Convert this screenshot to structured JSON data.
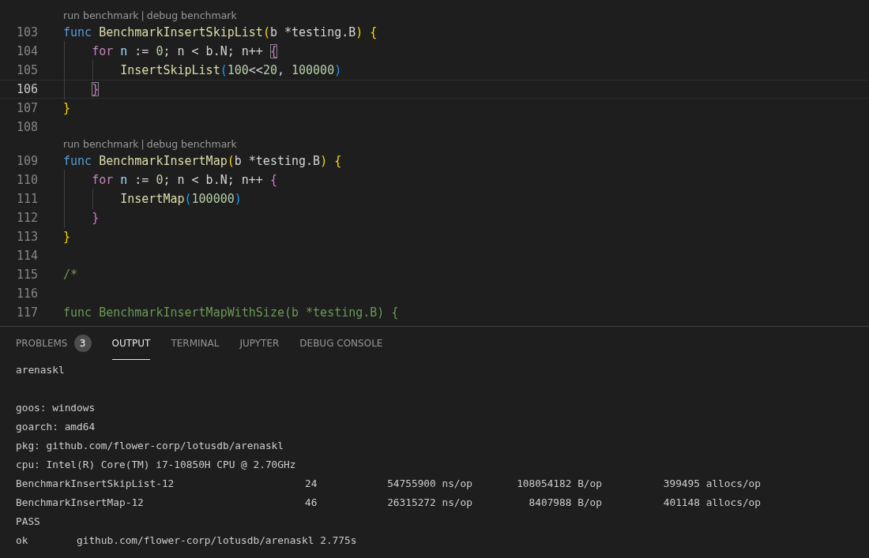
{
  "editor": {
    "lines": [
      {
        "kind": "lens",
        "run": "run benchmark",
        "sep": "|",
        "debug": "debug benchmark"
      },
      {
        "kind": "code",
        "number": "103",
        "current": false,
        "tokens": [
          {
            "kind": "kw",
            "t": "func"
          },
          {
            "kind": "fn",
            "t": " BenchmarkInsertSkipList"
          },
          {
            "kind": "brace1",
            "t": "("
          },
          {
            "kind": "plain",
            "t": "b *testing.B"
          },
          {
            "kind": "brace1",
            "t": ")"
          },
          {
            "kind": "brace1",
            "t": " {"
          }
        ]
      },
      {
        "kind": "code",
        "number": "104",
        "current": false,
        "tokens": [
          {
            "kind": "ctrl",
            "t": "    for"
          },
          {
            "kind": "var",
            "t": " n"
          },
          {
            "kind": "plain",
            "t": " := "
          },
          {
            "kind": "num",
            "t": "0"
          },
          {
            "kind": "plain",
            "t": "; n < b.N; n++ "
          },
          {
            "kind": "brace2",
            "t": "{",
            "matched": true
          }
        ]
      },
      {
        "kind": "code",
        "number": "105",
        "current": false,
        "tokens": [
          {
            "kind": "fn",
            "t": "        InsertSkipList"
          },
          {
            "kind": "brace3",
            "t": "("
          },
          {
            "kind": "num",
            "t": "100"
          },
          {
            "kind": "plain",
            "t": "<<"
          },
          {
            "kind": "num",
            "t": "20"
          },
          {
            "kind": "plain",
            "t": ", "
          },
          {
            "kind": "num",
            "t": "100000"
          },
          {
            "kind": "brace3",
            "t": ")"
          }
        ]
      },
      {
        "kind": "code",
        "number": "106",
        "current": true,
        "tokens": [
          {
            "kind": "brace2",
            "t": "    }",
            "matched": true
          }
        ]
      },
      {
        "kind": "code",
        "number": "107",
        "current": false,
        "tokens": [
          {
            "kind": "brace1",
            "t": "}"
          }
        ]
      },
      {
        "kind": "code",
        "number": "108",
        "current": false
      },
      {
        "kind": "lens",
        "run": "run benchmark",
        "sep": "|",
        "debug": "debug benchmark"
      },
      {
        "kind": "code",
        "number": "109",
        "current": false,
        "tokens": [
          {
            "kind": "kw",
            "t": "func"
          },
          {
            "kind": "fn",
            "t": " BenchmarkInsertMap"
          },
          {
            "kind": "brace1",
            "t": "("
          },
          {
            "kind": "plain",
            "t": "b *testing.B"
          },
          {
            "kind": "brace1",
            "t": ")"
          },
          {
            "kind": "brace1",
            "t": " {"
          }
        ]
      },
      {
        "kind": "code",
        "number": "110",
        "current": false,
        "tokens": [
          {
            "kind": "ctrl",
            "t": "    for"
          },
          {
            "kind": "var",
            "t": " n"
          },
          {
            "kind": "plain",
            "t": " := "
          },
          {
            "kind": "num",
            "t": "0"
          },
          {
            "kind": "plain",
            "t": "; n < b.N; n++ "
          },
          {
            "kind": "brace2",
            "t": "{"
          }
        ]
      },
      {
        "kind": "code",
        "number": "111",
        "current": false,
        "tokens": [
          {
            "kind": "fn",
            "t": "        InsertMap"
          },
          {
            "kind": "brace3",
            "t": "("
          },
          {
            "kind": "num",
            "t": "100000"
          },
          {
            "kind": "brace3",
            "t": ")"
          }
        ]
      },
      {
        "kind": "code",
        "number": "112",
        "current": false,
        "tokens": [
          {
            "kind": "brace2",
            "t": "    }"
          }
        ]
      },
      {
        "kind": "code",
        "number": "113",
        "current": false,
        "tokens": [
          {
            "kind": "brace1",
            "t": "}"
          }
        ]
      },
      {
        "kind": "code",
        "number": "114",
        "current": false
      },
      {
        "kind": "code",
        "number": "115",
        "current": false,
        "tokens": [
          {
            "kind": "comment",
            "t": "/*"
          }
        ]
      },
      {
        "kind": "code",
        "number": "116",
        "current": false
      },
      {
        "kind": "code",
        "number": "117",
        "current": false,
        "tokens": [
          {
            "kind": "comment",
            "t": "func BenchmarkInsertMapWithSize(b *testing.B) {"
          }
        ]
      }
    ]
  },
  "panel": {
    "tabs": [
      {
        "label": "PROBLEMS",
        "badge": "3",
        "selected": false
      },
      {
        "label": "OUTPUT",
        "selected": true
      },
      {
        "label": "TERMINAL",
        "selected": false
      },
      {
        "label": "JUPYTER",
        "selected": false
      },
      {
        "label": "DEBUG CONSOLE",
        "selected": false
      }
    ],
    "output": [
      {
        "kind": "text",
        "text": "arenaskl"
      },
      {
        "kind": "blank"
      },
      {
        "kind": "text",
        "text": "goos: windows"
      },
      {
        "kind": "text",
        "text": "goarch: amd64"
      },
      {
        "kind": "text",
        "text": "pkg: github.com/flower-corp/lotusdb/arenaskl"
      },
      {
        "kind": "text",
        "text": "cpu: Intel(R) Core(TM) i7-10850H CPU @ 2.70GHz"
      },
      {
        "kind": "bench",
        "cells": [
          "BenchmarkInsertSkipList-12",
          "24",
          "54755900 ns/op",
          "108054182 B/op",
          "399495 allocs/op"
        ]
      },
      {
        "kind": "bench",
        "cells": [
          "BenchmarkInsertMap-12",
          "46",
          "26315272 ns/op",
          "8407988 B/op",
          "401148 allocs/op"
        ]
      },
      {
        "kind": "text",
        "text": "PASS"
      },
      {
        "kind": "result",
        "cells": [
          "ok",
          "github.com/flower-corp/lotusdb/arenaskl 2.775s"
        ]
      }
    ]
  }
}
